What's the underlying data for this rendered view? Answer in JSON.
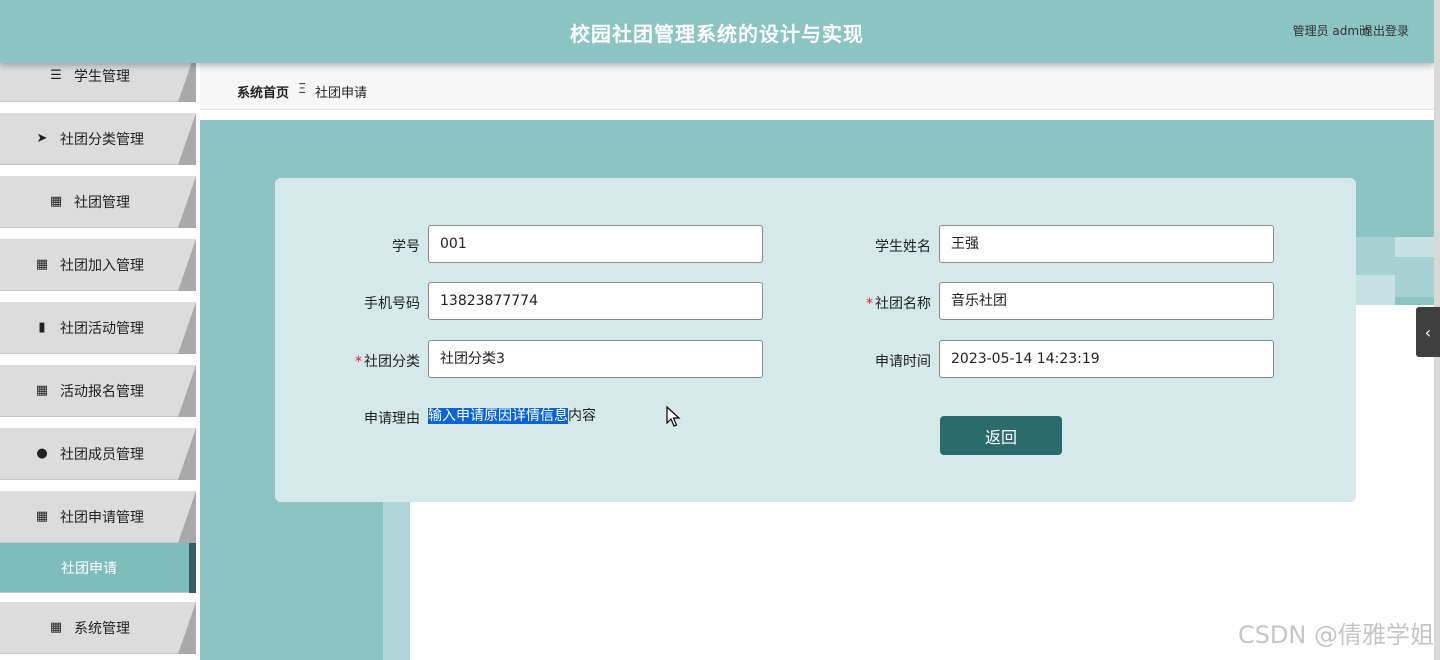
{
  "header": {
    "title": "校园社团管理系统的设计与实现",
    "user_label": "管理员 admin",
    "logout_label": "退出登录"
  },
  "sidebar": {
    "items": [
      {
        "label": "学生管理",
        "icon": "sliders-icon",
        "glyph": "☰"
      },
      {
        "label": "社团分类管理",
        "icon": "paper-plane-icon",
        "glyph": "➤"
      },
      {
        "label": "社团管理",
        "icon": "grid-icon",
        "glyph": "▦"
      },
      {
        "label": "社团加入管理",
        "icon": "grid-icon",
        "glyph": "▦"
      },
      {
        "label": "社团活动管理",
        "icon": "bar-chart-icon",
        "glyph": "▮"
      },
      {
        "label": "活动报名管理",
        "icon": "grid-icon",
        "glyph": "▦"
      },
      {
        "label": "社团成员管理",
        "icon": "bulb-icon",
        "glyph": "●"
      },
      {
        "label": "社团申请管理",
        "icon": "grid-icon",
        "glyph": "▦"
      },
      {
        "label": "社团申请",
        "icon": "",
        "glyph": "",
        "active": true
      },
      {
        "label": "系统管理",
        "icon": "grid-icon",
        "glyph": "▦"
      }
    ]
  },
  "breadcrumb": {
    "home": "系统首页",
    "separator": "Ξ",
    "current": "社团申请"
  },
  "form": {
    "student_no": {
      "label": "学号",
      "value": "001"
    },
    "student_name": {
      "label": "学生姓名",
      "value": "王强"
    },
    "phone": {
      "label": "手机号码",
      "value": "13823877774"
    },
    "club_name": {
      "label": "社团名称",
      "value": "音乐社团",
      "required": true
    },
    "club_category": {
      "label": "社团分类",
      "value": "社团分类3",
      "required": true
    },
    "apply_time": {
      "label": "申请时间",
      "value": "2023-05-14 14:23:19"
    },
    "reason": {
      "label": "申请理由",
      "selected_text": "输入申请原因详情信息",
      "rest_text": "内容"
    },
    "required_mark": "*",
    "back_label": "返回"
  },
  "collapse_tab": {
    "glyph": "‹"
  },
  "watermark": "CSDN @倩雅学姐",
  "colors": {
    "header": "#8cc3c3",
    "accent": "#2b6b6b",
    "card": "#d5e8ea",
    "selection": "#0a64d6"
  }
}
